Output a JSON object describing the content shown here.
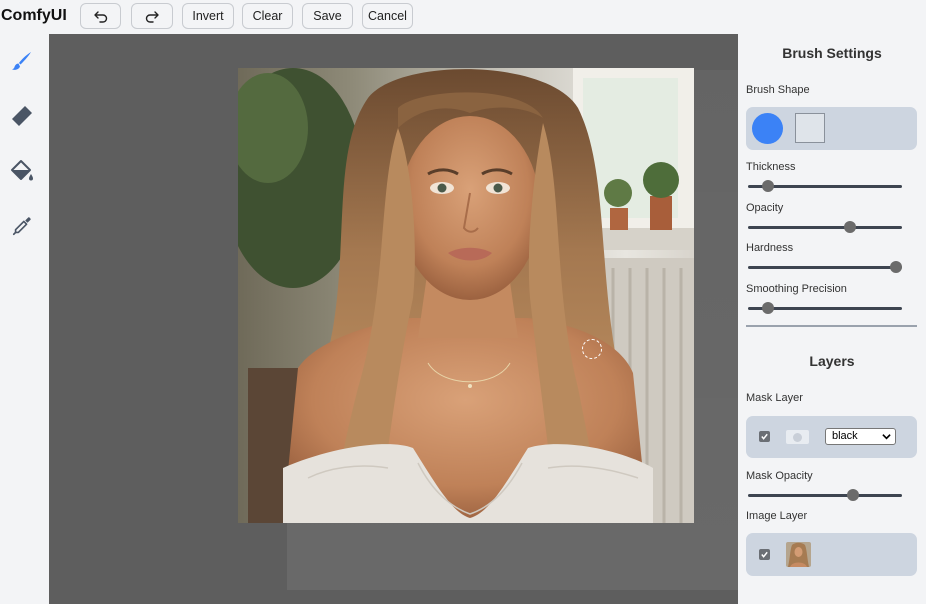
{
  "app": {
    "brand": "ComfyUI"
  },
  "toolbar": {
    "undo_icon": "undo-icon",
    "redo_icon": "redo-icon",
    "invert_label": "Invert",
    "clear_label": "Clear",
    "save_label": "Save",
    "cancel_label": "Cancel"
  },
  "tools": [
    {
      "name": "brush-tool",
      "icon": "brush-icon",
      "active": true
    },
    {
      "name": "eraser-tool",
      "icon": "eraser-icon",
      "active": false
    },
    {
      "name": "paint-bucket-tool",
      "icon": "paint-bucket-icon",
      "active": false
    },
    {
      "name": "color-picker-tool",
      "icon": "eyedropper-icon",
      "active": false
    }
  ],
  "brush_settings": {
    "title": "Brush Settings",
    "shape_label": "Brush Shape",
    "shapes": [
      "circle",
      "square"
    ],
    "selected_shape": "circle",
    "thickness_label": "Thickness",
    "thickness_value": 0.13,
    "opacity_label": "Opacity",
    "opacity_value": 0.66,
    "hardness_label": "Hardness",
    "hardness_value": 0.96,
    "smoothing_label": "Smoothing Precision",
    "smoothing_value": 0.13
  },
  "layers": {
    "title": "Layers",
    "mask_layer_label": "Mask Layer",
    "mask_layer_visible": true,
    "mask_color": "black",
    "mask_opacity_label": "Mask Opacity",
    "mask_opacity_value": 0.68,
    "image_layer_label": "Image Layer",
    "image_layer_visible": true
  },
  "colors": {
    "accent": "#3b82f6",
    "panel_bg": "#f3f4f6",
    "card_bg": "#cdd5e0",
    "canvas_bg": "#5e5e5e"
  }
}
